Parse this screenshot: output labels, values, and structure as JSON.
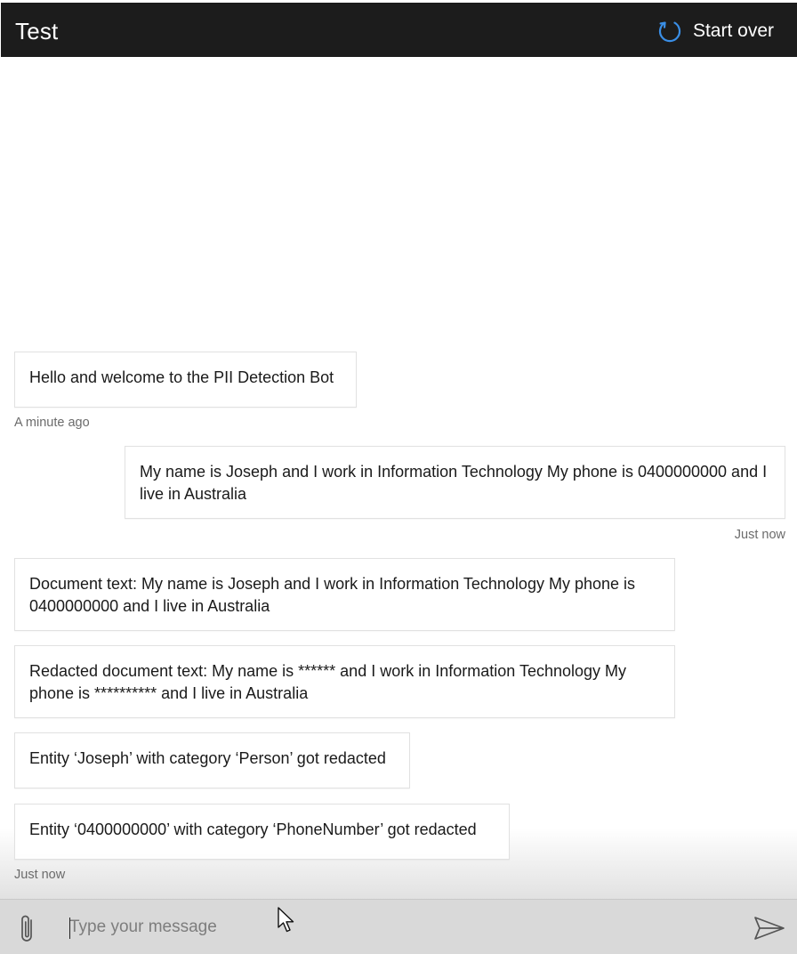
{
  "header": {
    "title": "Test",
    "restart_label": "Start over",
    "restart_icon": "refresh-icon",
    "accent_color": "#3a8ee6",
    "background_color": "#1c1c1c"
  },
  "messages": [
    {
      "from": "bot",
      "text": "Hello and welcome to the PII Detection Bot"
    },
    {
      "from": "user",
      "text": "My name is Joseph and I work in Information Technology My phone is 0400000000 and I live in Australia"
    },
    {
      "from": "bot",
      "text": "Document text: My name is Joseph and I work in Information Technology My phone is 0400000000 and I live in Australia"
    },
    {
      "from": "bot",
      "text": "Redacted document text: My name is ****** and I work in Information Technology My phone is ********** and I live in Australia"
    },
    {
      "from": "bot",
      "text": "Entity ‘Joseph’ with category ‘Person’ got redacted"
    },
    {
      "from": "bot",
      "text": "Entity ‘0400000000’ with category ‘PhoneNumber’ got redacted"
    }
  ],
  "timestamps": {
    "welcome": "A minute ago",
    "user": "Just now",
    "bot_replies": "Just now"
  },
  "composer": {
    "placeholder": "Type your message",
    "value": "",
    "attach_icon": "paperclip-icon",
    "send_icon": "send-icon"
  }
}
